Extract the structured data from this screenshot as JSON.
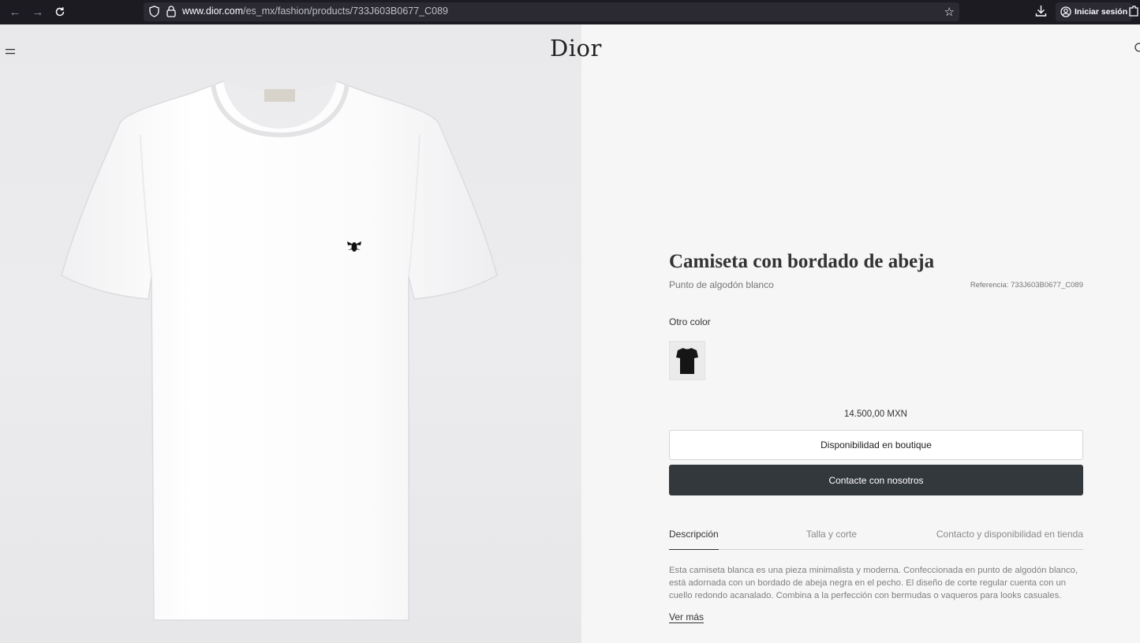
{
  "browser": {
    "url_host": "www.dior.com",
    "url_path": "/es_mx/fashion/products/733J603B0677_C089",
    "signin_label": "Iniciar sesión"
  },
  "header": {
    "logo": "Dior"
  },
  "product": {
    "title": "Camiseta con bordado de abeja",
    "subtitle": "Punto de algodón blanco",
    "reference": "Referencia: 733J603B0677_C089",
    "other_color_label": "Otro color",
    "price": "14.500,00 MXN",
    "boutique_button": "Disponibilidad en boutique",
    "contact_button": "Contacte con nosotros"
  },
  "tabs": [
    {
      "label": "Descripción"
    },
    {
      "label": "Talla y corte"
    },
    {
      "label": "Contacto y disponibilidad en tienda"
    }
  ],
  "description": {
    "text": "Esta camiseta blanca es una pieza minimalista y moderna. Confeccionada en punto de algodón blanco, está adornada con un bordado de abeja negra en el pecho. El diseño de corte regular cuenta con un cuello redondo acanalado. Combina a la perfección con bermudas o vaqueros para looks casuales.",
    "more_link": "Ver más"
  },
  "colors": {
    "chrome_bg": "#1c1b22",
    "button_dark": "#33383c",
    "page_bg": "#f6f6f6"
  }
}
